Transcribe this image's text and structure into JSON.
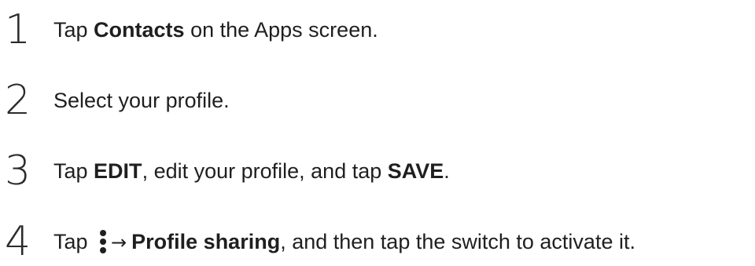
{
  "steps": [
    {
      "number": "1",
      "pre": "Tap ",
      "bold": "Contacts",
      "post": " on the Apps screen."
    },
    {
      "number": "2",
      "text": "Select your profile."
    },
    {
      "number": "3",
      "pre": "Tap ",
      "bold1": "EDIT",
      "mid": ", edit your profile, and tap ",
      "bold2": "SAVE",
      "post": "."
    },
    {
      "number": "4",
      "pre": "Tap ",
      "icon": "more-options-icon",
      "arrow": "→",
      "bold": "Profile sharing",
      "post": ", and then tap the switch to activate it."
    }
  ]
}
